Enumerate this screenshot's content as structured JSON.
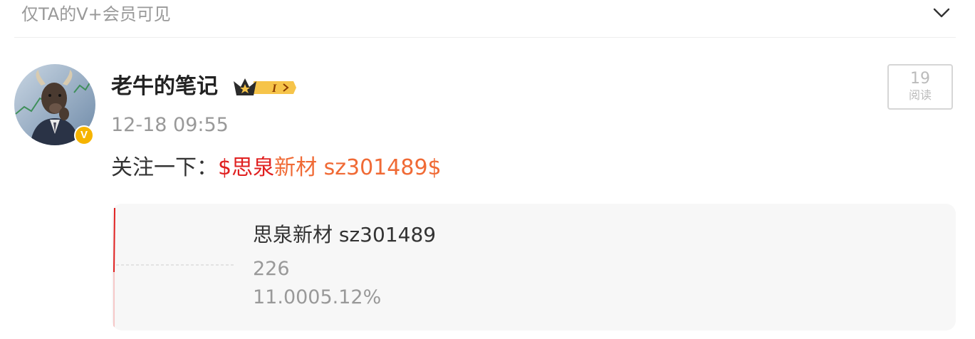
{
  "visibility_notice": "仅TA的V+会员可见",
  "post": {
    "author": {
      "name": "老牛的笔记",
      "verified_icon": "v-badge-icon",
      "level_badge": "I"
    },
    "timestamp": "12-18 09:55",
    "reads": {
      "count": "19",
      "label": "阅读"
    },
    "content": {
      "prefix": "关注一下：",
      "stock_link_a": "$思泉",
      "stock_link_b": "新材 sz301489$"
    },
    "stock_card": {
      "name": "思泉新材 sz301489",
      "price": "226",
      "change": "11.0005.12%"
    }
  },
  "colors": {
    "link": "#f06a35",
    "link_highlight": "#e02020",
    "muted": "#999999",
    "card_bg": "#f7f7f7",
    "badge_gold": "#f6b400",
    "sparkline": "#e02020"
  }
}
